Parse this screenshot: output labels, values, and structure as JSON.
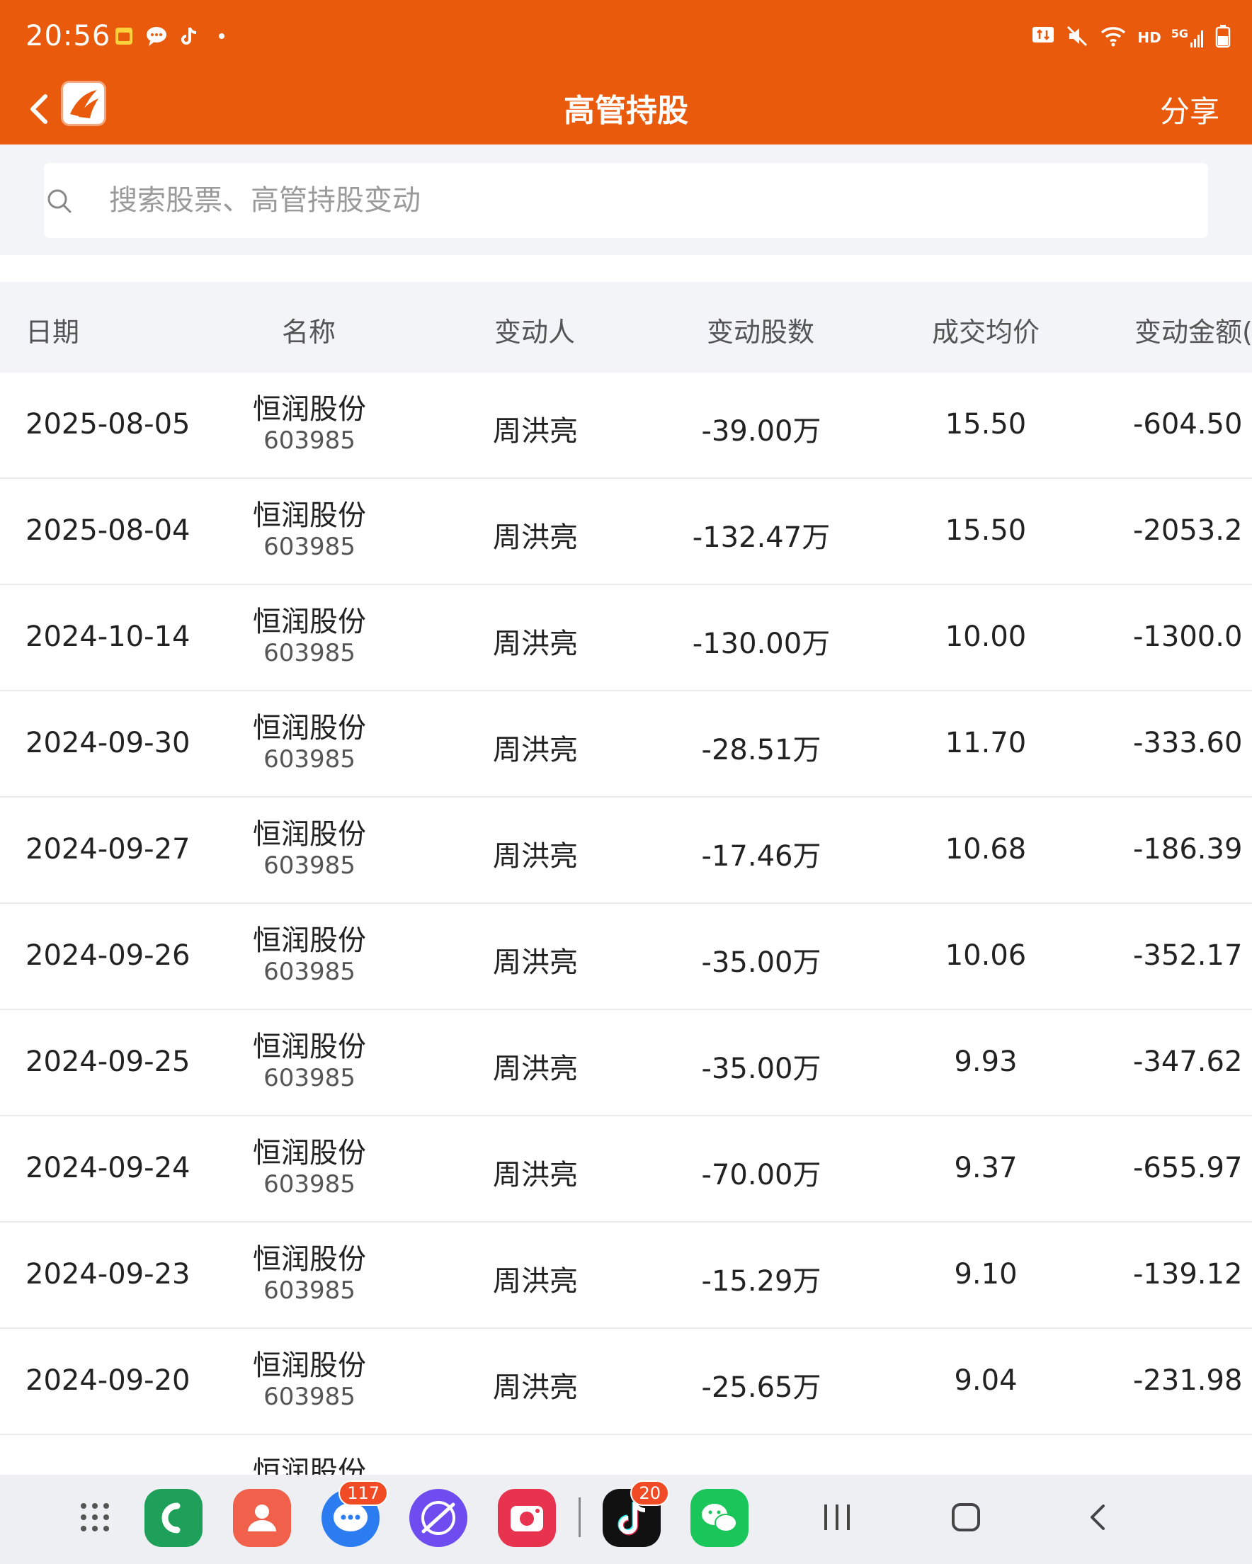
{
  "status_bar": {
    "time": "20:56",
    "network": "HD",
    "signal": "5G"
  },
  "nav": {
    "title": "高管持股",
    "share_label": "分享"
  },
  "search": {
    "placeholder": "搜索股票、高管持股变动"
  },
  "table": {
    "columns": [
      "日期",
      "名称",
      "变动人",
      "变动股数",
      "成交均价",
      "变动金额("
    ],
    "rows": [
      {
        "date": "2025-08-05",
        "name": "恒润股份",
        "code": "603985",
        "person": "周洪亮",
        "shares": "-39.00万",
        "price": "15.50",
        "amount": "-604.50"
      },
      {
        "date": "2025-08-04",
        "name": "恒润股份",
        "code": "603985",
        "person": "周洪亮",
        "shares": "-132.47万",
        "price": "15.50",
        "amount": "-2053.2"
      },
      {
        "date": "2024-10-14",
        "name": "恒润股份",
        "code": "603985",
        "person": "周洪亮",
        "shares": "-130.00万",
        "price": "10.00",
        "amount": "-1300.0"
      },
      {
        "date": "2024-09-30",
        "name": "恒润股份",
        "code": "603985",
        "person": "周洪亮",
        "shares": "-28.51万",
        "price": "11.70",
        "amount": "-333.60"
      },
      {
        "date": "2024-09-27",
        "name": "恒润股份",
        "code": "603985",
        "person": "周洪亮",
        "shares": "-17.46万",
        "price": "10.68",
        "amount": "-186.39"
      },
      {
        "date": "2024-09-26",
        "name": "恒润股份",
        "code": "603985",
        "person": "周洪亮",
        "shares": "-35.00万",
        "price": "10.06",
        "amount": "-352.17"
      },
      {
        "date": "2024-09-25",
        "name": "恒润股份",
        "code": "603985",
        "person": "周洪亮",
        "shares": "-35.00万",
        "price": "9.93",
        "amount": "-347.62"
      },
      {
        "date": "2024-09-24",
        "name": "恒润股份",
        "code": "603985",
        "person": "周洪亮",
        "shares": "-70.00万",
        "price": "9.37",
        "amount": "-655.97"
      },
      {
        "date": "2024-09-23",
        "name": "恒润股份",
        "code": "603985",
        "person": "周洪亮",
        "shares": "-15.29万",
        "price": "9.10",
        "amount": "-139.12"
      },
      {
        "date": "2024-09-20",
        "name": "恒润股份",
        "code": "603985",
        "person": "周洪亮",
        "shares": "-25.65万",
        "price": "9.04",
        "amount": "-231.98"
      },
      {
        "date": "",
        "name": "恒润股份",
        "code": "",
        "person": "",
        "shares": "",
        "price": "",
        "amount": ""
      }
    ]
  },
  "dock": {
    "apps": [
      {
        "name": "app-drawer",
        "icon": "grid-icon"
      },
      {
        "name": "phone",
        "icon": "phone-icon",
        "color": "#1EA05A"
      },
      {
        "name": "contacts",
        "icon": "person-icon",
        "color": "#F0604A"
      },
      {
        "name": "messages",
        "icon": "chat-icon",
        "color": "#2A7CF0",
        "badge": "117"
      },
      {
        "name": "browser",
        "icon": "browser-icon",
        "color": "#6E4CF0"
      },
      {
        "name": "camera",
        "icon": "camera-icon",
        "color": "#E8334F"
      },
      {
        "name": "tiktok",
        "icon": "tiktok-icon",
        "color": "#111111",
        "badge": "20"
      },
      {
        "name": "wechat",
        "icon": "wechat-icon",
        "color": "#1AC65A"
      }
    ]
  },
  "colors": {
    "brand": "#E95A0C",
    "header_bg": "#F3F4F7"
  }
}
